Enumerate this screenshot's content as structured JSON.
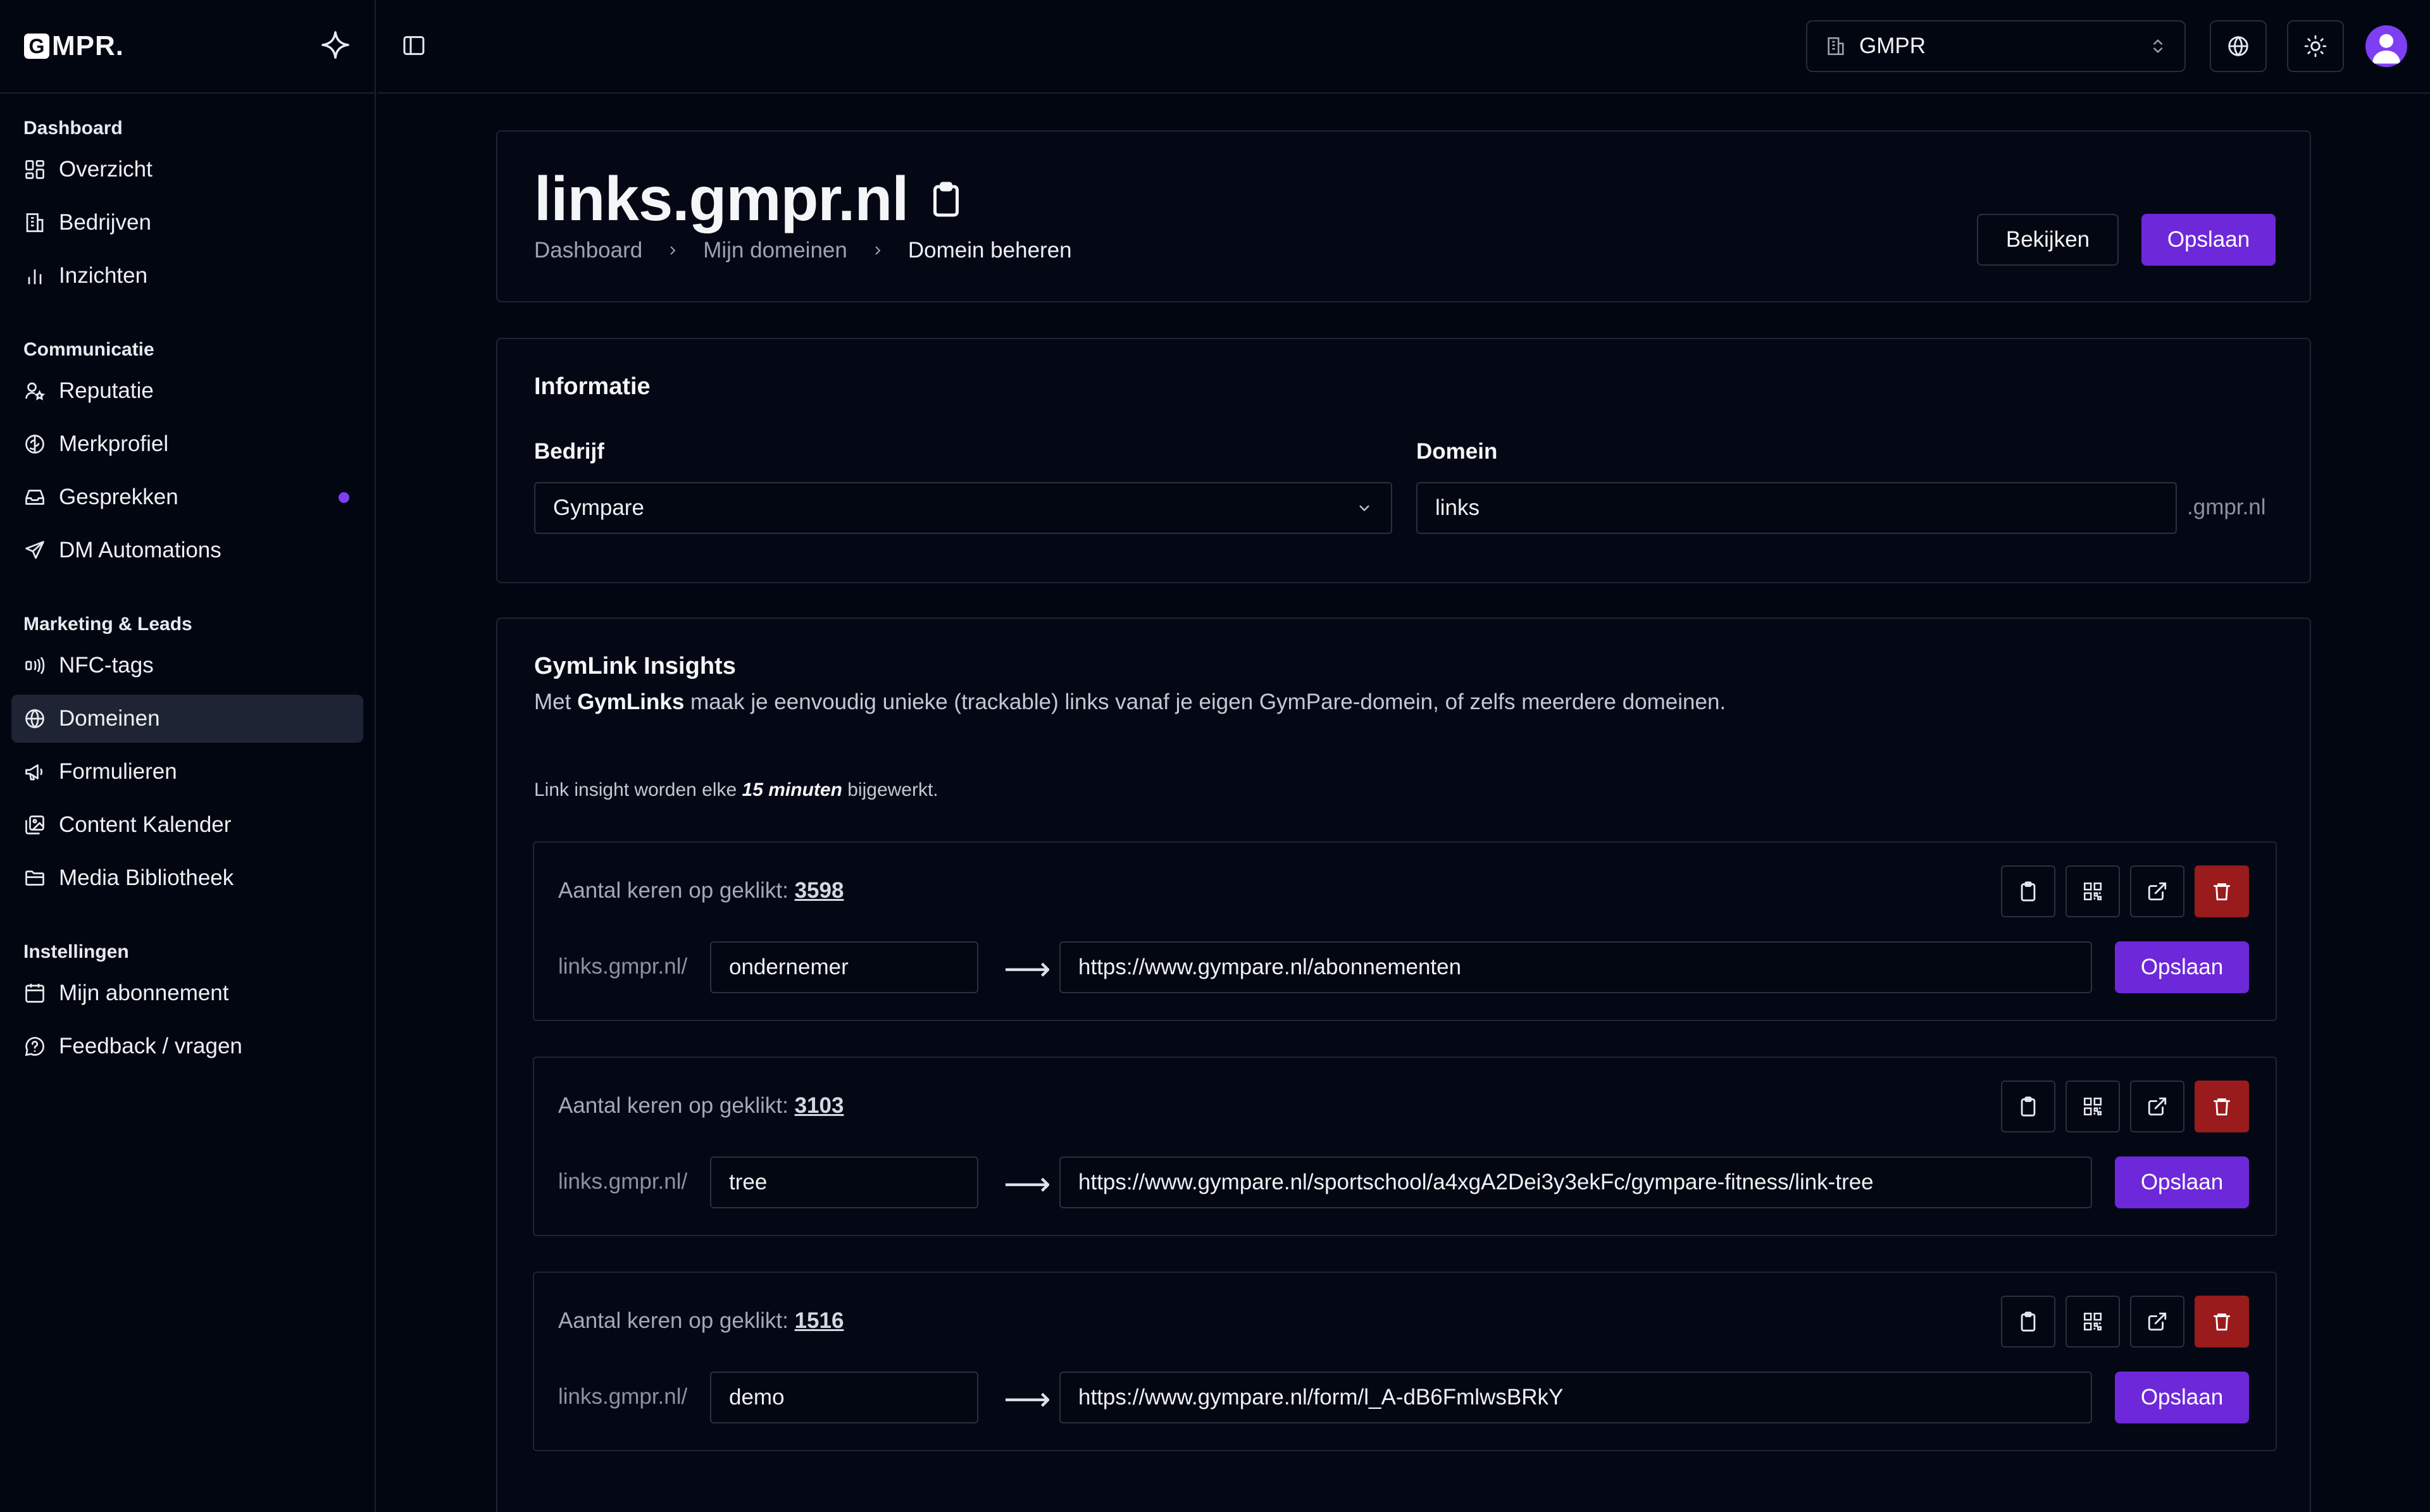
{
  "brand": {
    "logo_letter": "G",
    "logo_text": "MPR."
  },
  "sidebar": {
    "sections": [
      {
        "heading": "Dashboard",
        "items": [
          {
            "label": "Overzicht",
            "icon": "grid-icon"
          },
          {
            "label": "Bedrijven",
            "icon": "building-icon"
          },
          {
            "label": "Inzichten",
            "icon": "bar-chart-icon"
          }
        ]
      },
      {
        "heading": "Communicatie",
        "items": [
          {
            "label": "Reputatie",
            "icon": "user-star-icon"
          },
          {
            "label": "Merkprofiel",
            "icon": "brain-icon"
          },
          {
            "label": "Gesprekken",
            "icon": "inbox-icon",
            "badge": "dot"
          },
          {
            "label": "DM Automations",
            "icon": "send-icon"
          }
        ]
      },
      {
        "heading": "Marketing & Leads",
        "items": [
          {
            "label": "NFC-tags",
            "icon": "nfc-icon"
          },
          {
            "label": "Domeinen",
            "icon": "globe-icon",
            "active": true
          },
          {
            "label": "Formulieren",
            "icon": "megaphone-icon"
          },
          {
            "label": "Content Kalender",
            "icon": "images-icon"
          },
          {
            "label": "Media Bibliotheek",
            "icon": "folder-icon"
          }
        ]
      },
      {
        "heading": "Instellingen",
        "items": [
          {
            "label": "Mijn abonnement",
            "icon": "calendar-icon"
          },
          {
            "label": "Feedback / vragen",
            "icon": "help-circle-icon"
          }
        ]
      }
    ]
  },
  "topbar": {
    "org_select": "GMPR"
  },
  "header": {
    "title": "links.gmpr.nl",
    "breadcrumb": [
      "Dashboard",
      "Mijn domeinen",
      "Domein beheren"
    ],
    "view_label": "Bekijken",
    "save_label": "Opslaan"
  },
  "info": {
    "title": "Informatie",
    "company_label": "Bedrijf",
    "company_value": "Gympare",
    "domain_label": "Domein",
    "domain_value": "links",
    "domain_suffix": ".gmpr.nl"
  },
  "insights": {
    "title": "GymLink Insights",
    "desc_pre": "Met ",
    "desc_bold": "GymLinks",
    "desc_post": " maak je eenvoudig unieke (trackable) links vanaf je eigen GymPare-domein, of zelfs meerdere domeinen.",
    "note_pre": "Link insight worden elke ",
    "note_bold": "15 minuten",
    "note_post": " bijgewerkt.",
    "clicks_label": "Aantal keren op geklikt: ",
    "prefix": "links.gmpr.nl/",
    "save_label": "Opslaan",
    "links": [
      {
        "clicks": "3598",
        "slug": "ondernemer",
        "target": "https://www.gympare.nl/abonnementen"
      },
      {
        "clicks": "3103",
        "slug": "tree",
        "target": "https://www.gympare.nl/sportschool/a4xgA2Dei3y3ekFc/gympare-fitness/link-tree"
      },
      {
        "clicks": "1516",
        "slug": "demo",
        "target": "https://www.gympare.nl/form/l_A-dB6FmlwsBRkY"
      }
    ]
  },
  "colors": {
    "accent": "#6d28d9",
    "danger": "#991b1b",
    "background": "#020611"
  }
}
